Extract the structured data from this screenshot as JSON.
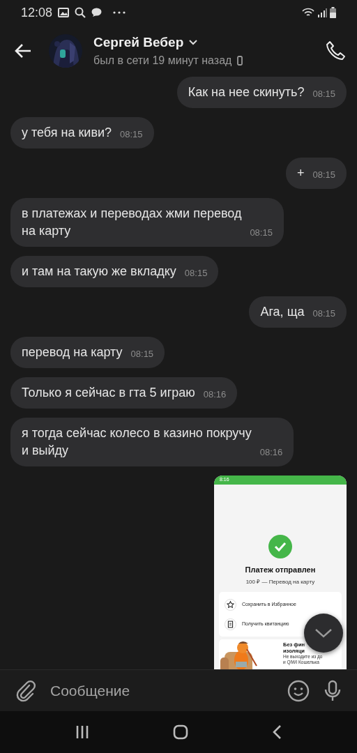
{
  "status_bar": {
    "time": "12:08"
  },
  "header": {
    "name": "Сергей Вебер",
    "status": "был в сети 19 минут назад"
  },
  "messages": [
    {
      "kind": "text",
      "outgoing": true,
      "text": "Как на нее скинуть?",
      "time": "08:15"
    },
    {
      "kind": "text",
      "outgoing": false,
      "text": "у тебя на киви?",
      "time": "08:15"
    },
    {
      "kind": "text",
      "outgoing": true,
      "text": "+",
      "time": "08:15"
    },
    {
      "kind": "text",
      "outgoing": false,
      "text": "в платежах и переводах жми перевод\nна карту",
      "time": "08:15"
    },
    {
      "kind": "text",
      "outgoing": false,
      "text": "и там на такую же вкладку",
      "time": "08:15"
    },
    {
      "kind": "text",
      "outgoing": true,
      "text": "Ага, ща",
      "time": "08:15"
    },
    {
      "kind": "text",
      "outgoing": false,
      "text": "перевод на карту",
      "time": "08:15"
    },
    {
      "kind": "text",
      "outgoing": false,
      "text": "Только я сейчас в гта 5 играю",
      "time": "08:16"
    },
    {
      "kind": "text",
      "outgoing": false,
      "text": "я тогда сейчас колесо в казино покручу\nи выйду",
      "time": "08:16"
    },
    {
      "kind": "screenshot",
      "outgoing": true,
      "shot": {
        "time": "8:16",
        "title": "Платеж отправлен",
        "subtitle": "100 ₽ — Перевод на карту",
        "actions": [
          {
            "kind": "star",
            "label": "Сохранить в Избранное"
          },
          {
            "kind": "receipt",
            "label": "Получить квитанцию"
          }
        ],
        "promo": {
          "title_lines": [
            "Без фин",
            "изоляци"
          ],
          "text_lines": [
            "Не выходите из до",
            "и QIWI Кошелька"
          ]
        }
      }
    }
  ],
  "composer": {
    "placeholder": "Сообщение"
  }
}
